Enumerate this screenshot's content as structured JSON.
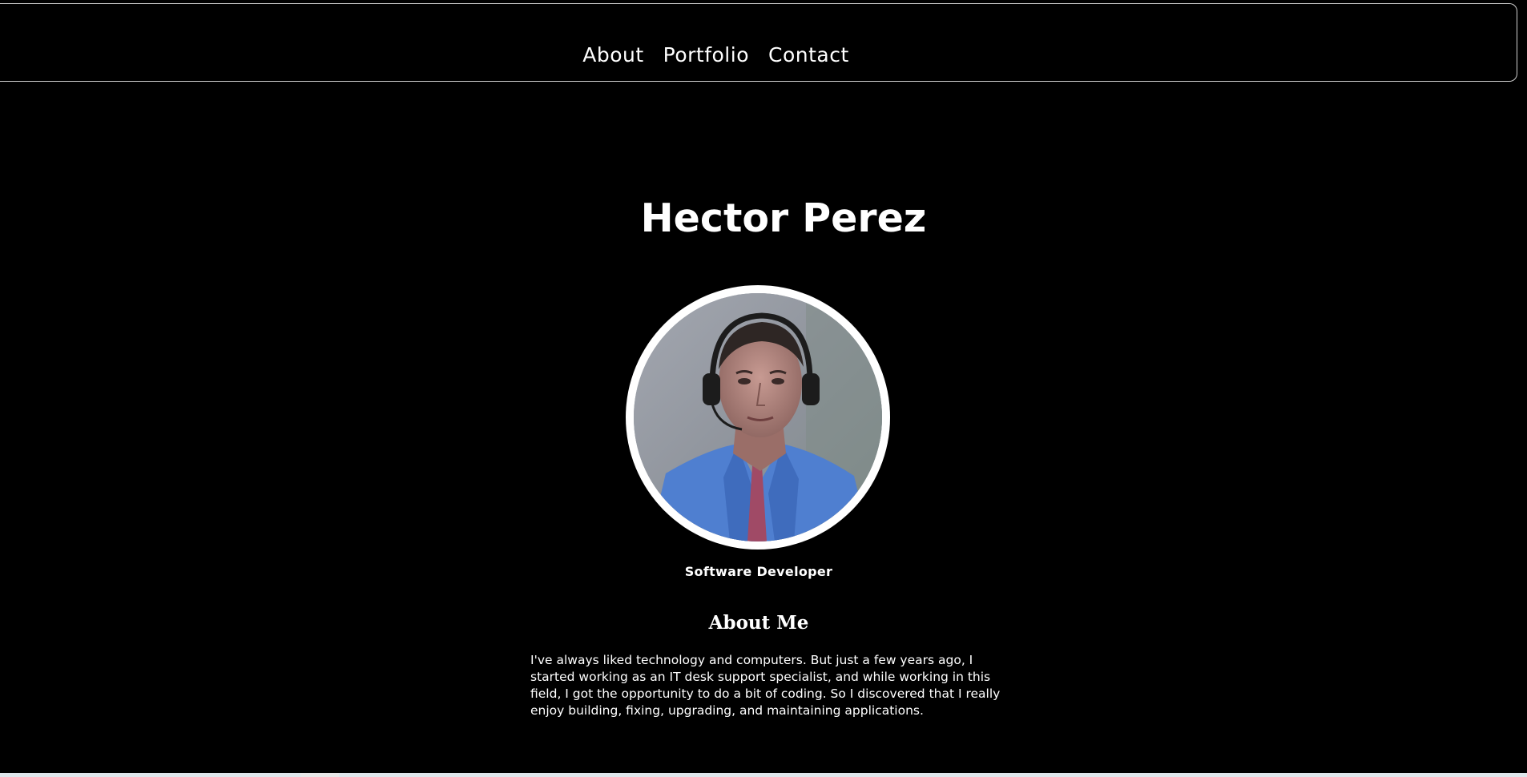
{
  "nav": {
    "items": [
      {
        "label": "About"
      },
      {
        "label": "Portfolio"
      },
      {
        "label": "Contact"
      }
    ]
  },
  "hero": {
    "name": "Hector Perez",
    "role": "Software Developer"
  },
  "about": {
    "heading": "About Me",
    "body": "I've always liked technology and computers. But just a few years ago, I started working as an IT desk support specialist, and while working in this field, I got the opportunity to do a bit of coding. So I discovered that I really enjoy building, fixing, upgrading, and maintaining applications."
  },
  "colors": {
    "background": "#000000",
    "text": "#ffffff",
    "nav_border": "#cfcfcf",
    "shirt": "#4f7fd0"
  }
}
